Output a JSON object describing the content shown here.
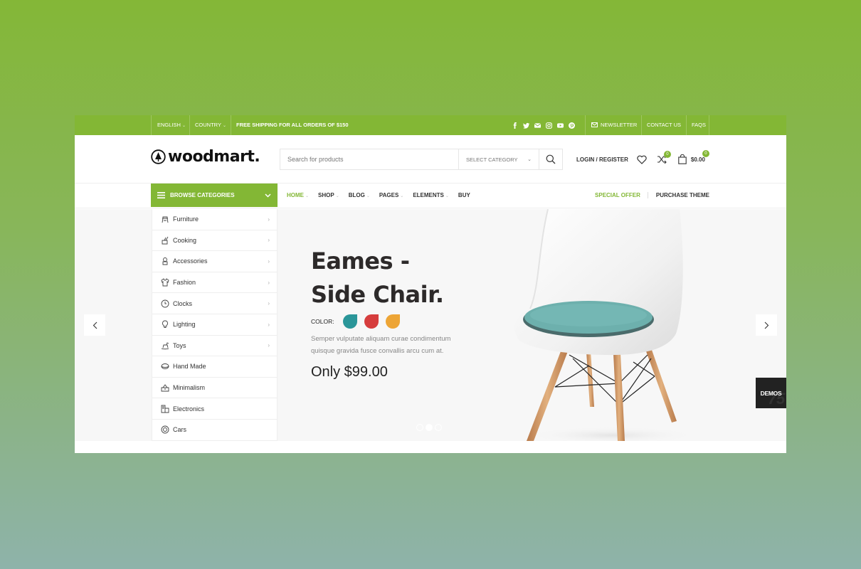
{
  "colors": {
    "brand": "#83b735",
    "drop_teal": "#2a9699",
    "drop_red": "#d63d3d",
    "drop_orange": "#eda536"
  },
  "topbar": {
    "language": "ENGLISH",
    "country": "COUNTRY",
    "shipping": "FREE SHIPPING FOR ALL ORDERS OF $150",
    "socials": [
      "facebook-icon",
      "twitter-icon",
      "email-icon",
      "instagram-icon",
      "youtube-icon",
      "pinterest-icon"
    ],
    "newsletter": "NEWSLETTER",
    "contact": "CONTACT US",
    "faqs": "FAQS"
  },
  "header": {
    "logo": "woodmart.",
    "search_placeholder": "Search for products",
    "select_category": "SELECT CATEGORY",
    "login": "LOGIN / REGISTER",
    "compare_count": "0",
    "cart_count": "0",
    "cart_total": "$0.00"
  },
  "nav": {
    "browse": "BROWSE CATEGORIES",
    "items": [
      {
        "label": "HOME",
        "caret": true,
        "active": true
      },
      {
        "label": "SHOP",
        "caret": true
      },
      {
        "label": "BLOG",
        "caret": true
      },
      {
        "label": "PAGES",
        "caret": true
      },
      {
        "label": "ELEMENTS",
        "caret": true
      },
      {
        "label": "BUY",
        "caret": false
      }
    ],
    "special_offer": "SPECIAL OFFER",
    "purchase": "PURCHASE THEME"
  },
  "categories": [
    {
      "label": "Furniture",
      "icon": "furniture-icon",
      "arrow": true
    },
    {
      "label": "Cooking",
      "icon": "cooking-icon",
      "arrow": true
    },
    {
      "label": "Accessories",
      "icon": "accessories-icon",
      "arrow": true
    },
    {
      "label": "Fashion",
      "icon": "fashion-icon",
      "arrow": true
    },
    {
      "label": "Clocks",
      "icon": "clock-icon",
      "arrow": true
    },
    {
      "label": "Lighting",
      "icon": "lighting-icon",
      "arrow": true
    },
    {
      "label": "Toys",
      "icon": "toys-icon",
      "arrow": true
    },
    {
      "label": "Hand Made",
      "icon": "hand-made-icon",
      "arrow": false
    },
    {
      "label": "Minimalism",
      "icon": "minimalism-icon",
      "arrow": false
    },
    {
      "label": "Electronics",
      "icon": "electronics-icon",
      "arrow": false
    },
    {
      "label": "Cars",
      "icon": "cars-icon",
      "arrow": false
    }
  ],
  "slide": {
    "title_line1": "Eames -",
    "title_line2": "Side Chair.",
    "color_label": "COLOR:",
    "description_line1": "Semper vulputate aliquam curae condimentum",
    "description_line2": "quisque gravida fusce convallis arcu cum at.",
    "price": "Only $99.00",
    "slide_count": 3,
    "active_slide": 2
  },
  "demos": {
    "label": "DEMOS",
    "count": "75"
  }
}
